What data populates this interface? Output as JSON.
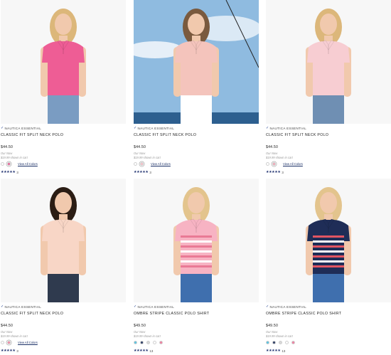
{
  "products": [
    {
      "brand": "NAUTICA ESSENTIAL",
      "name": "CLASSIC FIT SPLIT NECK POLO",
      "price": "$44.50",
      "our_now": "Our Now",
      "cart_note": "$19.99 shown in cart",
      "swatches": [
        "#ffffff",
        "#e8679a"
      ],
      "view_all": "View All Colors",
      "stars": "★★★★★",
      "rating_count": "3",
      "photo": {
        "bg": "#f7f7f7",
        "shirt": "#ee5d95",
        "stripes": [],
        "bottom": "#7a9cc2",
        "hair": "#dcb77a",
        "scene": "studio"
      }
    },
    {
      "brand": "NAUTICA ESSENTIAL",
      "name": "CLASSIC FIT SPLIT NECK POLO",
      "price": "$44.50",
      "our_now": "Our Now",
      "cart_note": "$19.99 shown in cart",
      "swatches": [
        "#ffffff",
        "#f6c2c9"
      ],
      "view_all": "View All Colors",
      "stars": "★★★★★",
      "rating_count": "3",
      "photo": {
        "bg": "#9fc4e0",
        "shirt": "#f4c4bc",
        "stripes": [],
        "bottom": "#ffffff",
        "hair": "#7a5a3e",
        "scene": "sky"
      }
    },
    {
      "brand": "NAUTICA ESSENTIAL",
      "name": "CLASSIC FIT SPLIT NECK POLO",
      "price": "$44.50",
      "our_now": "Our Now",
      "cart_note": "$19.99 shown in cart",
      "swatches": [
        "#ffffff",
        "#f3a9b8"
      ],
      "view_all": "View All Colors",
      "stars": "★★★★★",
      "rating_count": "3",
      "photo": {
        "bg": "#f7f7f7",
        "shirt": "#f7cdd2",
        "stripes": [],
        "bottom": "#6f8fb3",
        "hair": "#dcb77a",
        "scene": "studio"
      }
    },
    {
      "brand": "NAUTICA ESSENTIAL",
      "name": "CLASSIC FIT SPLIT NECK POLO",
      "price": "$44.50",
      "our_now": "Our Now",
      "cart_note": "$19.99 shown in cart",
      "swatches": [
        "#ffffff",
        "#f28aa5"
      ],
      "view_all": "View All Colors",
      "stars": "★★★★★",
      "rating_count": "3",
      "photo": {
        "bg": "#f7f7f7",
        "shirt": "#f8d6c6",
        "stripes": [],
        "bottom": "#2f3a4e",
        "hair": "#2b1d14",
        "scene": "studio"
      }
    },
    {
      "brand": "NAUTICA ESSENTIAL",
      "name": "OMBRE STRIPE CLASSIC POLO SHIRT",
      "price": "$49.50",
      "our_now": "Our Now",
      "cart_note": "$19.99 shown in cart",
      "swatches": [
        "#5bc3e0",
        "#2f3f66",
        "#d8d8d8",
        "#ffffff",
        "#ef7fa0"
      ],
      "view_all": "",
      "stars": "★★★★★",
      "rating_count": "13",
      "photo": {
        "bg": "#f7f7f7",
        "shirt": "#f7b3c3",
        "stripes": [
          "#e97a95",
          "#ffffff"
        ],
        "bottom": "#3f6fae",
        "hair": "#e3c48d",
        "scene": "studio"
      }
    },
    {
      "brand": "NAUTICA ESSENTIAL",
      "name": "OMBRE STRIPE CLASSIC POLO SHIRT",
      "price": "$49.50",
      "our_now": "Our Now",
      "cart_note": "$19.99 shown in cart",
      "swatches": [
        "#5bc3e0",
        "#2f3f66",
        "#d8d8d8",
        "#ffffff",
        "#ef7fa0"
      ],
      "view_all": "",
      "stars": "★★★★★",
      "rating_count": "13",
      "photo": {
        "bg": "#f7f7f7",
        "shirt": "#1f2d57",
        "stripes": [
          "#e25563",
          "#ffffff"
        ],
        "bottom": "#3f6fae",
        "hair": "#e3c48d",
        "scene": "studio"
      }
    }
  ]
}
